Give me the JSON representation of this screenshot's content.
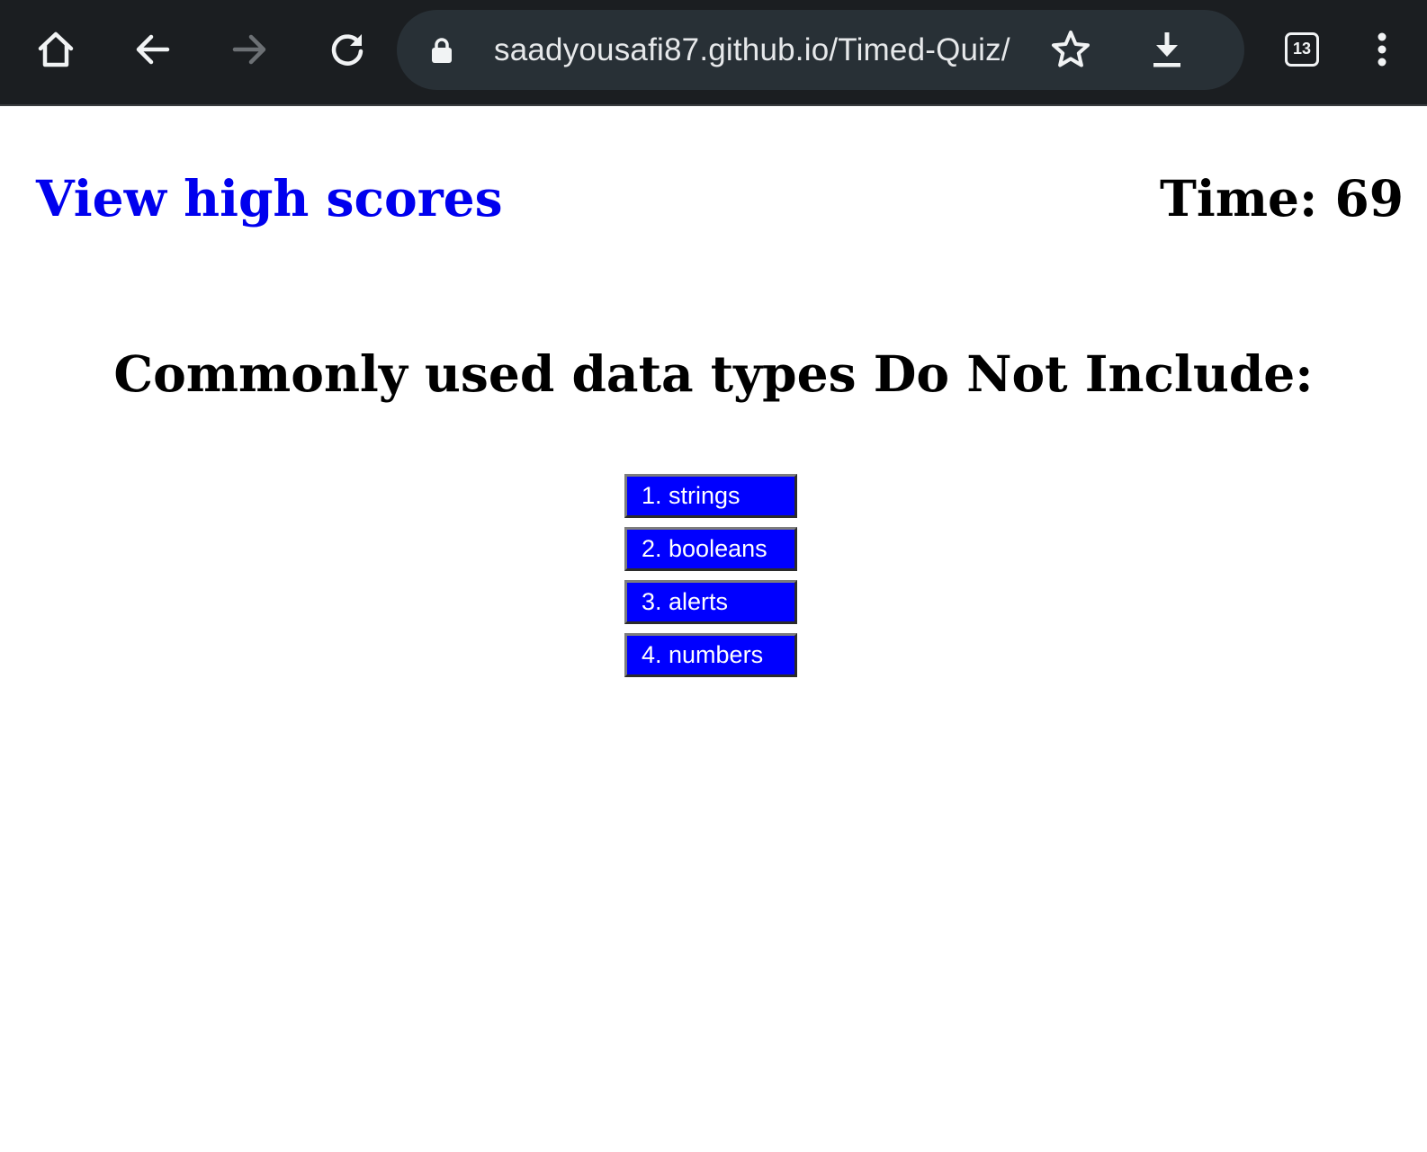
{
  "browser": {
    "url": "saadyousafi87.github.io/Timed-Quiz/",
    "tab_count": "13",
    "icons": [
      "home-icon",
      "back-icon",
      "forward-icon",
      "reload-icon",
      "lock-icon",
      "star-icon",
      "download-icon",
      "tabs-icon",
      "menu-icon"
    ],
    "colors": {
      "toolbar_bg": "#1b1e21",
      "urlbar_bg": "#283036",
      "icon": "#f1f3f4",
      "icon_disabled": "#6c7074"
    }
  },
  "page": {
    "high_scores_link": "View high scores",
    "timer": "Time: 69",
    "question": "Commonly used data types Do Not Include:",
    "answers": [
      {
        "label": "1. strings"
      },
      {
        "label": "2. booleans"
      },
      {
        "label": "3. alerts"
      },
      {
        "label": "4. numbers"
      }
    ],
    "colors": {
      "link": "#0000ee",
      "answer_bg": "#0000ff",
      "answer_text": "#ffffff"
    }
  }
}
